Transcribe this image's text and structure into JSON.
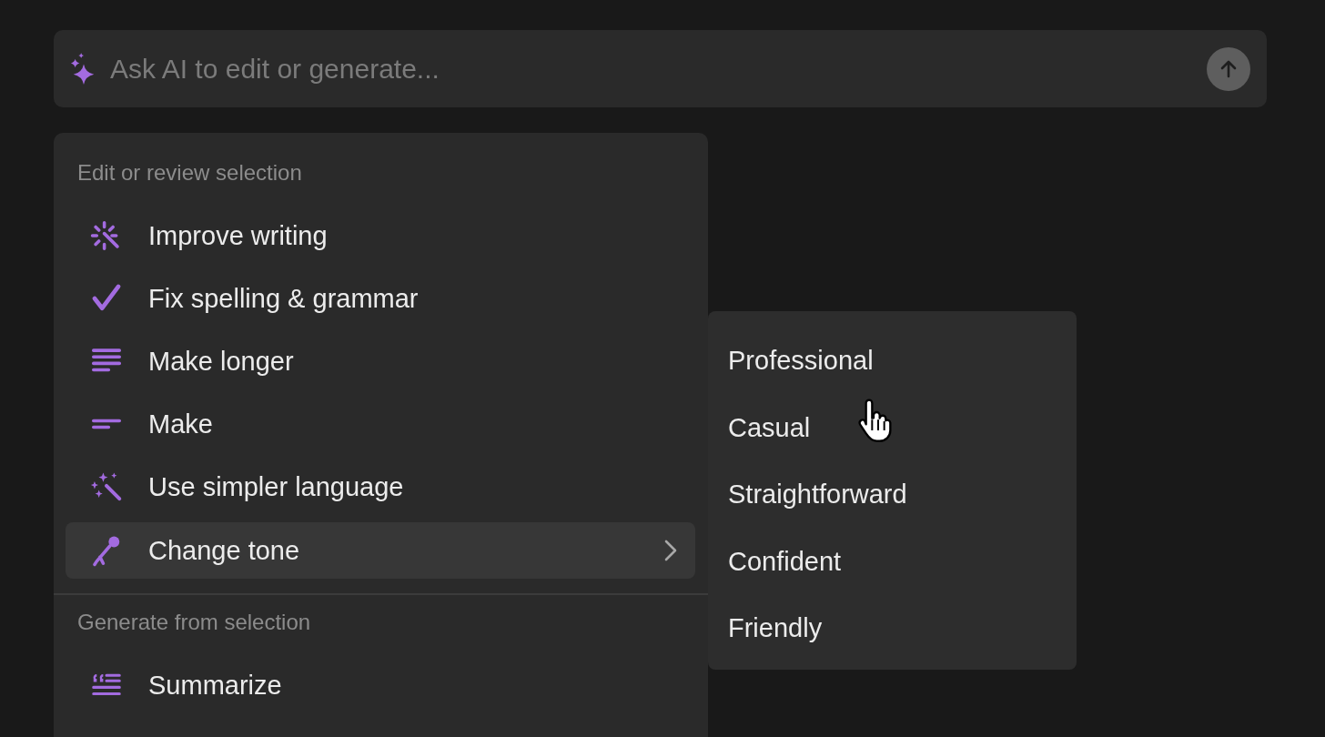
{
  "prompt": {
    "placeholder": "Ask AI to edit or generate..."
  },
  "menu": {
    "sections": [
      {
        "heading": "Edit or review selection",
        "items": [
          {
            "label": "Improve writing",
            "kind": "wand-burst",
            "selected": false,
            "has_submenu": false
          },
          {
            "label": "Fix spelling & grammar",
            "kind": "check",
            "selected": false,
            "has_submenu": false
          },
          {
            "label": "Make longer",
            "kind": "lines-long",
            "selected": false,
            "has_submenu": false
          },
          {
            "label": "Make",
            "kind": "lines-short",
            "selected": false,
            "has_submenu": false
          },
          {
            "label": "Use simpler language",
            "kind": "wand-stars",
            "selected": false,
            "has_submenu": false
          },
          {
            "label": "Change tone",
            "kind": "microphone",
            "selected": true,
            "has_submenu": true
          }
        ]
      },
      {
        "heading": "Generate from selection",
        "items": [
          {
            "label": "Summarize",
            "kind": "quote-lines",
            "selected": false,
            "has_submenu": false
          }
        ]
      }
    ]
  },
  "submenu": {
    "items": [
      "Professional",
      "Casual",
      "Straightforward",
      "Confident",
      "Friendly"
    ]
  }
}
